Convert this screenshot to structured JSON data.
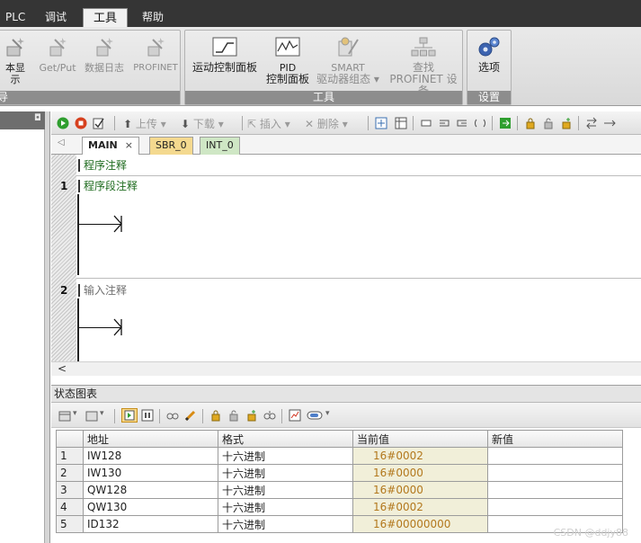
{
  "menu": {
    "plc": "PLC",
    "debug": "调试",
    "tools": "工具",
    "help": "帮助"
  },
  "ribbon": {
    "group_left_buttons": [
      {
        "label": "本显示",
        "icon": "wand-icon"
      },
      {
        "label": "Get/Put",
        "icon": "wand-icon"
      },
      {
        "label": "数据日志",
        "icon": "wand-icon"
      },
      {
        "label": "PROFINET",
        "icon": "wand-icon"
      }
    ],
    "group_left_label": "导",
    "tools_group": {
      "motion_panel": "运动控制面板",
      "pid_panel_line1": "PID",
      "pid_panel_line2": "控制面板",
      "smart_line1": "SMART",
      "smart_line2": "驱动器组态",
      "find_line1": "查找",
      "find_line2": "PROFINET 设备",
      "label": "工具"
    },
    "settings_group": {
      "options": "选项",
      "label": "设置"
    }
  },
  "editor_toolbar": {
    "upload": "上传",
    "download": "下载",
    "insert": "插入",
    "delete": "删除"
  },
  "tabs": [
    {
      "label": "MAIN",
      "close": "×"
    },
    {
      "label": "SBR_0"
    },
    {
      "label": "INT_0"
    }
  ],
  "ladder": {
    "program_comment": "程序注释",
    "networks": [
      {
        "number": "1",
        "comment": "程序段注释"
      },
      {
        "number": "2",
        "comment": "输入注释"
      }
    ]
  },
  "status_chart": {
    "title": "状态图表",
    "columns": [
      "地址",
      "格式",
      "当前值",
      "新值"
    ],
    "rows": [
      {
        "n": "1",
        "address": "IW128",
        "format": "十六进制",
        "value": "16#0002",
        "new": ""
      },
      {
        "n": "2",
        "address": "IW130",
        "format": "十六进制",
        "value": "16#0000",
        "new": ""
      },
      {
        "n": "3",
        "address": "QW128",
        "format": "十六进制",
        "value": "16#0000",
        "new": ""
      },
      {
        "n": "4",
        "address": "QW130",
        "format": "十六进制",
        "value": "16#0002",
        "new": ""
      },
      {
        "n": "5",
        "address": "ID132",
        "format": "十六进制",
        "value": "16#00000000",
        "new": ""
      }
    ]
  },
  "watermark": "CSDN @ddjy88"
}
